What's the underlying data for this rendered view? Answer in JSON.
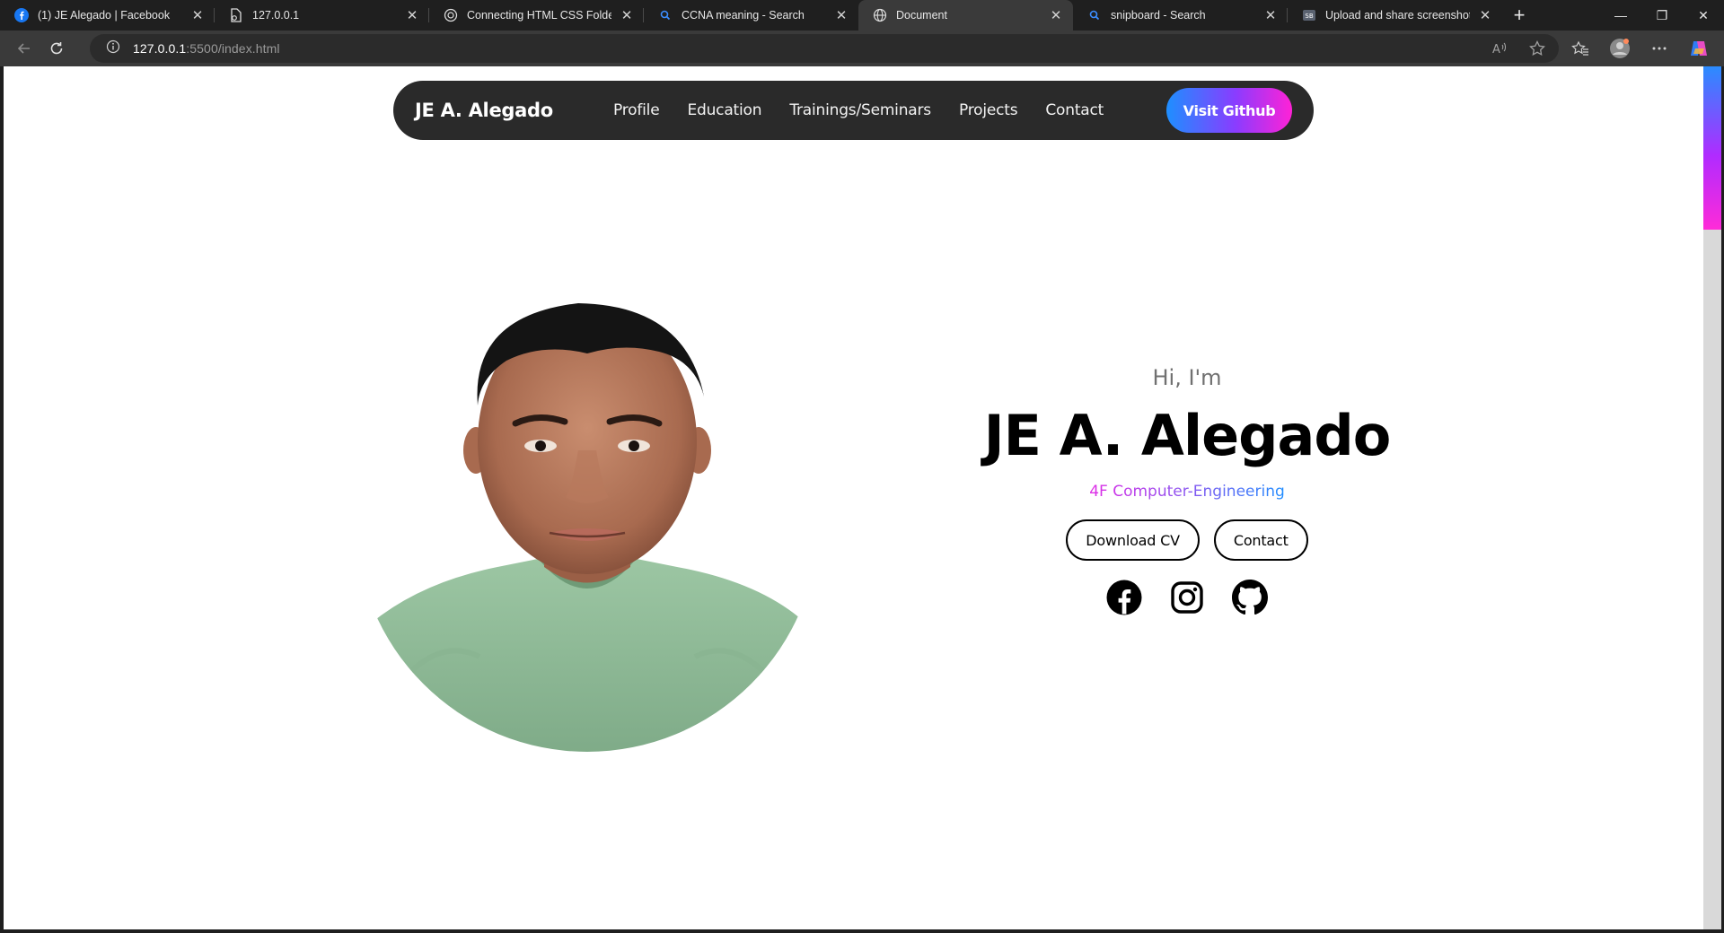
{
  "browser": {
    "tabs": [
      {
        "title": "(1) JE Alegado | Facebook",
        "icon": "facebook-icon",
        "active": false
      },
      {
        "title": "127.0.0.1",
        "icon": "file-icon",
        "active": false
      },
      {
        "title": "Connecting HTML CSS Folders",
        "icon": "openai-icon",
        "active": false
      },
      {
        "title": "CCNA meaning - Search",
        "icon": "search-icon",
        "active": false
      },
      {
        "title": "Document",
        "icon": "globe-icon",
        "active": true
      },
      {
        "title": "snipboard - Search",
        "icon": "search-icon",
        "active": false
      },
      {
        "title": "Upload and share screenshots an",
        "icon": "snipboard-icon",
        "active": false
      }
    ],
    "address": {
      "host": "127.0.0.1",
      "path": ":5500/index.html"
    }
  },
  "page": {
    "nav": {
      "brand": "JE A. Alegado",
      "links": [
        "Profile",
        "Education",
        "Trainings/Seminars",
        "Projects",
        "Contact"
      ],
      "cta": "Visit Github"
    },
    "hero": {
      "greeting": "Hi, I'm",
      "name": "JE A. Alegado",
      "role": "4F Computer-Engineering",
      "buttons": {
        "download": "Download CV",
        "contact": "Contact"
      },
      "socials": [
        "facebook-icon",
        "instagram-icon",
        "github-icon"
      ]
    },
    "colors": {
      "nav_bg": "#2a2a2a",
      "gradient_start": "#1e8fff",
      "gradient_mid": "#8a3cff",
      "gradient_end": "#ff22d6"
    }
  }
}
